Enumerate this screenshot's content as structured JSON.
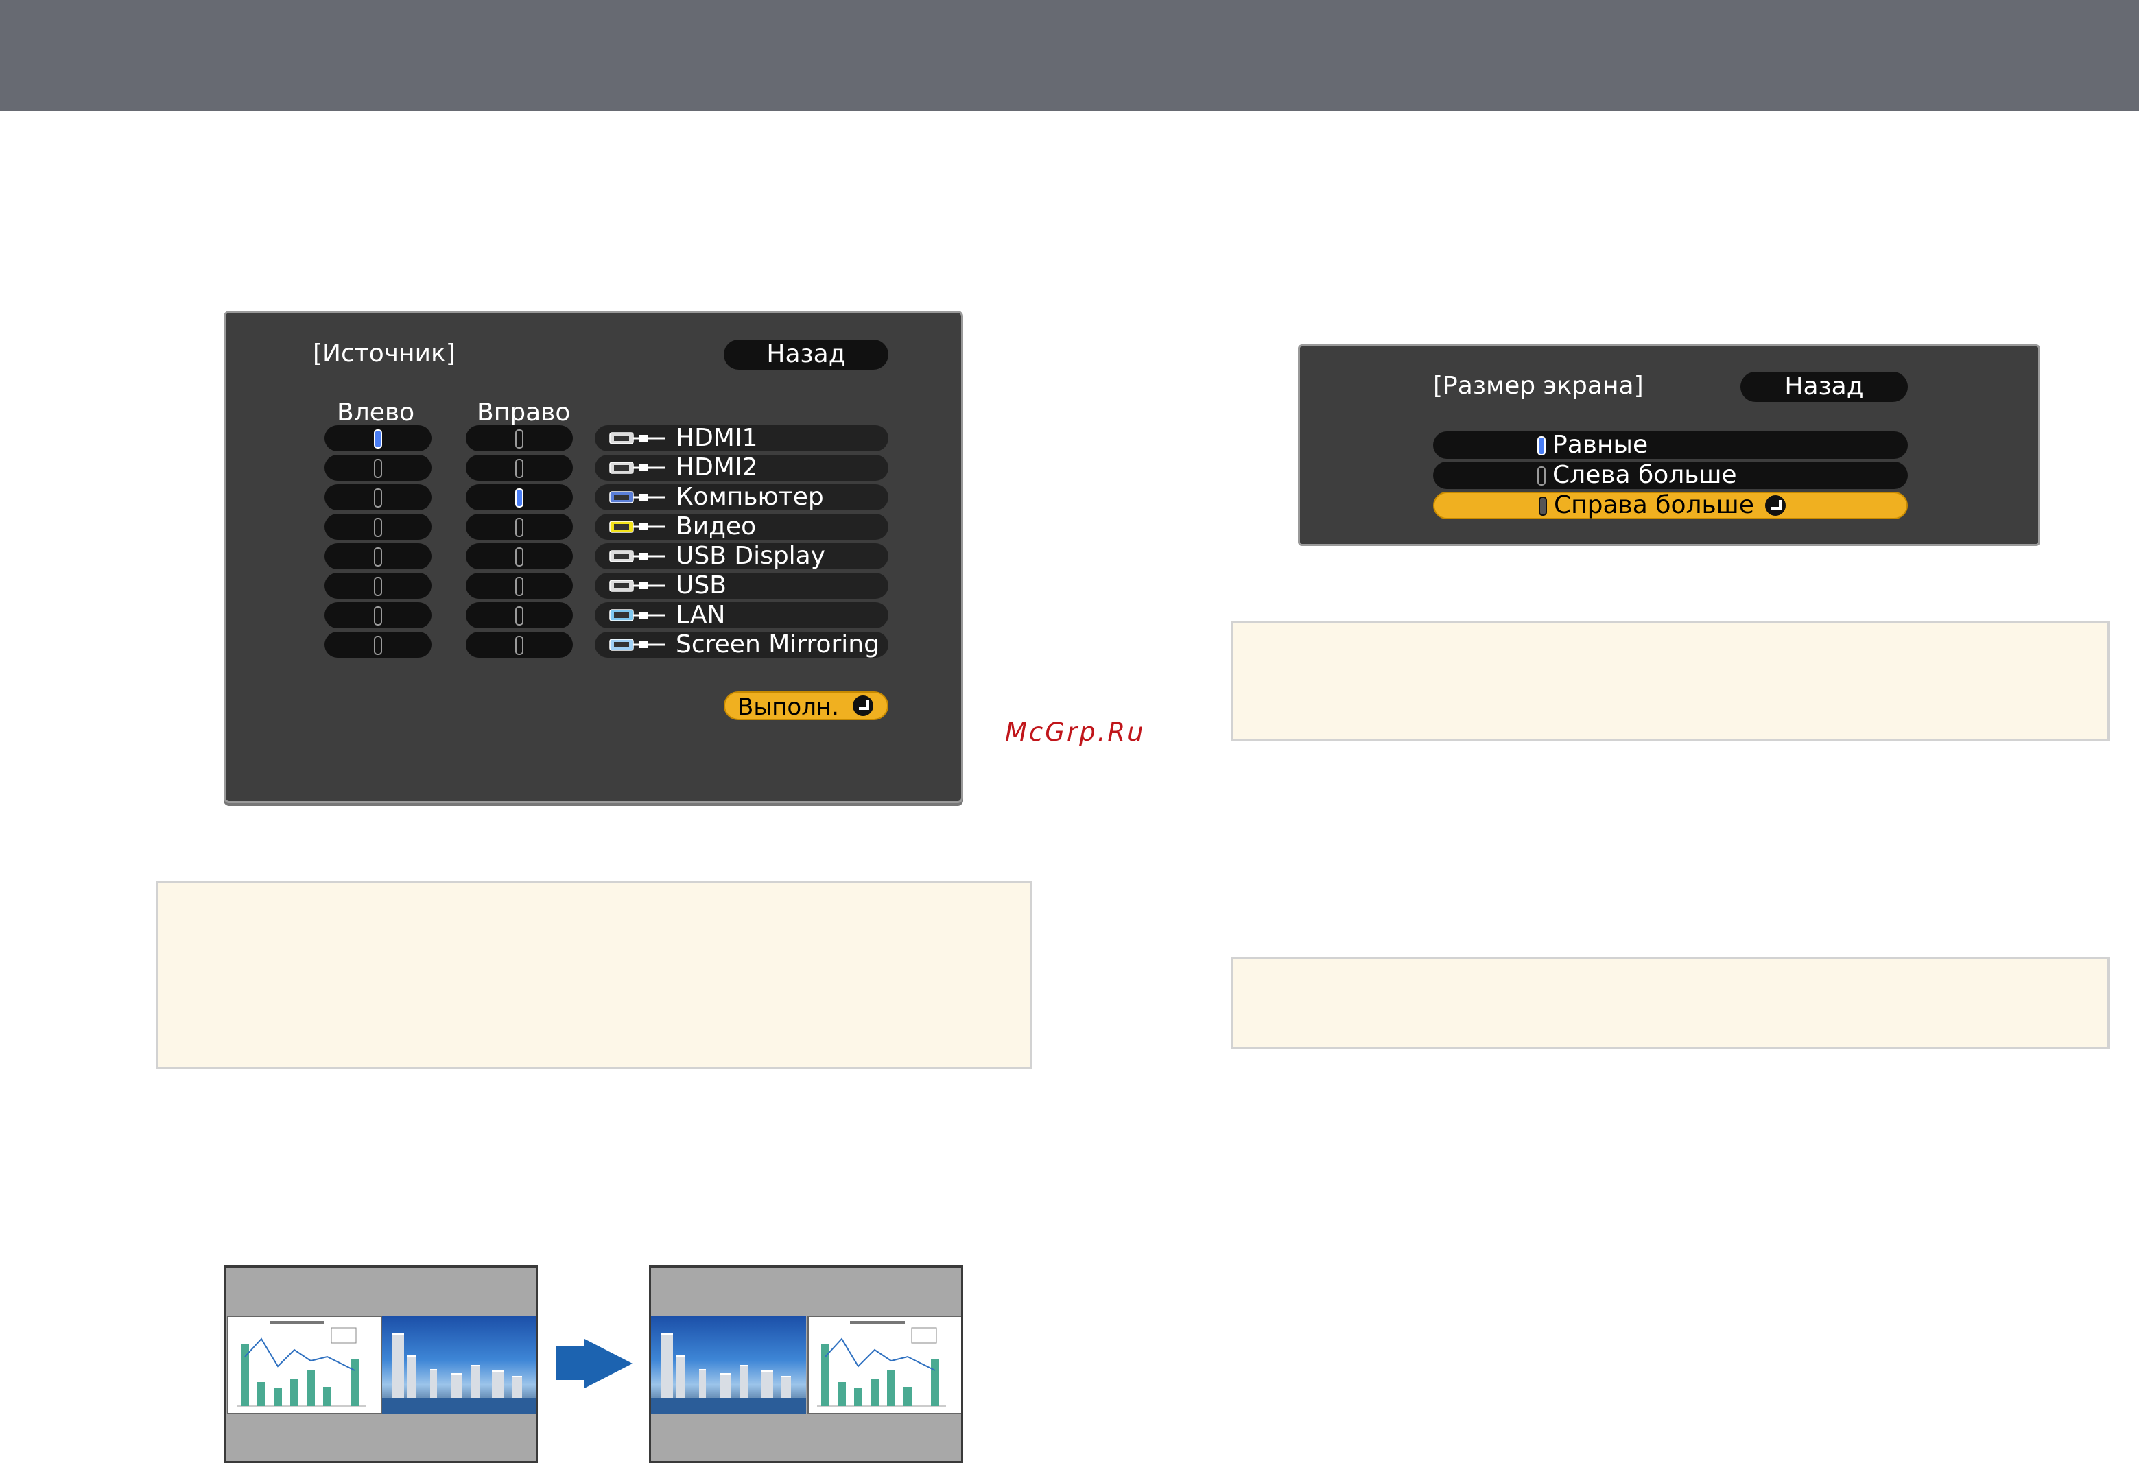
{
  "source_panel": {
    "title": "[Источник]",
    "back_label": "Назад",
    "left_label": "Влево",
    "right_label": "Вправо",
    "execute_label": "Выполн.",
    "left_selected_index": 0,
    "right_selected_index": 2,
    "sources": [
      {
        "label": "HDMI1",
        "icon": "hdmi-icon"
      },
      {
        "label": "HDMI2",
        "icon": "hdmi-icon"
      },
      {
        "label": "Компьютер",
        "icon": "computer-vga-icon"
      },
      {
        "label": "Видео",
        "icon": "video-rca-icon"
      },
      {
        "label": "USB Display",
        "icon": "usb-display-icon"
      },
      {
        "label": "USB",
        "icon": "usb-icon"
      },
      {
        "label": "LAN",
        "icon": "lan-icon"
      },
      {
        "label": "Screen Mirroring",
        "icon": "screen-mirroring-icon"
      }
    ]
  },
  "screen_size_panel": {
    "title": "[Размер экрана]",
    "back_label": "Назад",
    "options": [
      {
        "label": "Равные",
        "selected": true,
        "highlighted": false
      },
      {
        "label": "Слева больше",
        "selected": false,
        "highlighted": false
      },
      {
        "label": "Справа больше",
        "selected": false,
        "highlighted": true
      }
    ]
  },
  "watermark": "McGrp.Ru",
  "colors": {
    "topbar": "#676a72",
    "panel_bg": "#3e3e3e",
    "highlight": "#f0b020",
    "note_bg": "#fdf7e8",
    "arrow": "#1c63b0",
    "watermark": "#c0151a"
  }
}
